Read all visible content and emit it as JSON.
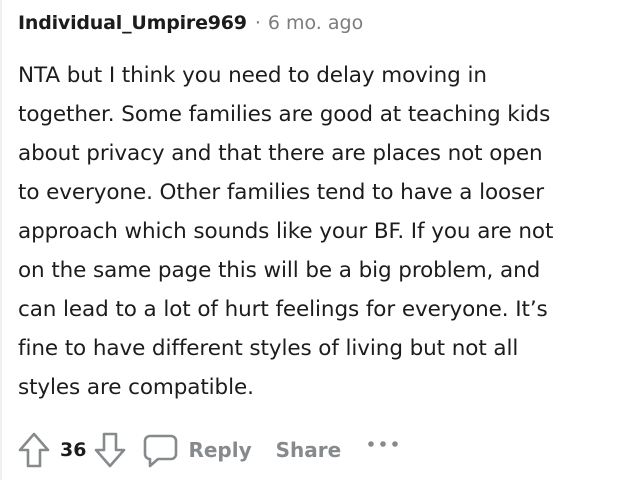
{
  "comment": {
    "author": "Individual_Umpire969",
    "separator": "·",
    "timestamp": "6 mo. ago",
    "body": "NTA but I think you need to delay moving in\ntogether. Some families are good at teaching kids\nabout privacy and that there are places not open\nto everyone. Other families tend to have a looser\napproach which sounds like your BF. If you are not\non the same page this will be a big problem, and\ncan lead to a lot of hurt feelings for everyone. It’s\nfine to have different styles of living but not all\nstyles are compatible."
  },
  "actions": {
    "upvote_icon": "upvote-arrow-icon",
    "score": "36",
    "downvote_icon": "downvote-arrow-icon",
    "reply_icon": "speech-bubble-icon",
    "reply_label": "Reply",
    "share_label": "Share",
    "more_icon": "more-options-icon"
  },
  "colors": {
    "text": "#1c1c1c",
    "meta": "#7c7c7c",
    "action": "#878a8c"
  }
}
